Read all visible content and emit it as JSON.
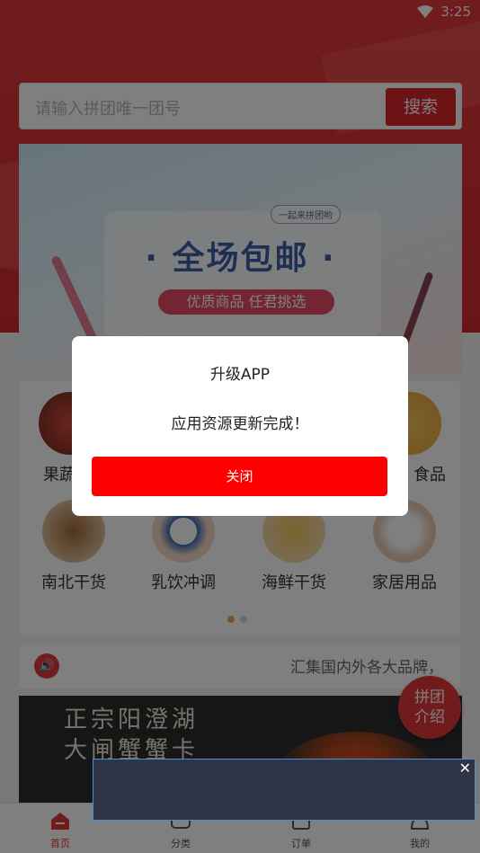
{
  "status": {
    "time": "3:25"
  },
  "search": {
    "placeholder": "请输入拼团唯一团号",
    "button": "搜索"
  },
  "banner": {
    "tag": "一起来拼团哟",
    "headline": "· 全场包邮 ·",
    "subline": "优质商品 任君挑选"
  },
  "categories": [
    {
      "label": "果蔬",
      "color": "#b43a2a"
    },
    {
      "label": "食品",
      "color": "#f0b34a"
    },
    {
      "label": "南北干货",
      "color": "#8a5a2a"
    },
    {
      "label": "乳饮冲调",
      "color": "#3d6db3"
    },
    {
      "label": "海鲜干货",
      "color": "#e3b24a"
    },
    {
      "label": "家居用品",
      "color": "#e8dccf"
    }
  ],
  "notice": {
    "text": "汇集国内外各大品牌，犭"
  },
  "promo": {
    "line1": "正宗阳澄湖",
    "line2": "大闸蟹蟹卡"
  },
  "float_button": {
    "line1": "拼团",
    "line2": "介绍"
  },
  "tabbar": [
    {
      "label": "首页",
      "icon": "home-icon",
      "active": true
    },
    {
      "label": "分类",
      "icon": "category-icon",
      "active": false
    },
    {
      "label": "订单",
      "icon": "order-icon",
      "active": false
    },
    {
      "label": "我的",
      "icon": "profile-icon",
      "active": false
    }
  ],
  "dialog": {
    "title": "升级APP",
    "message": "应用资源更新完成！",
    "close": "关闭"
  },
  "ad": {
    "close": "✕"
  }
}
